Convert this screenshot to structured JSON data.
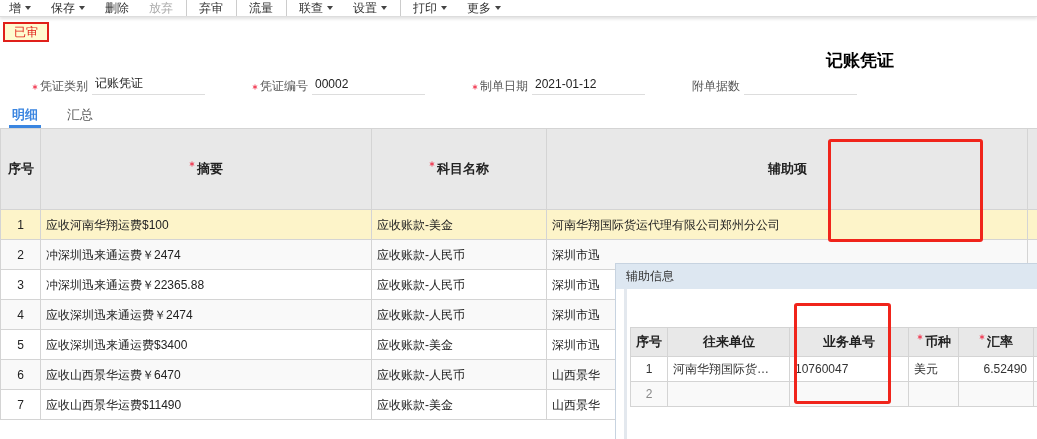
{
  "toolbar": [
    {
      "label": "增",
      "has_menu": true,
      "disabled": false,
      "separator_before": false
    },
    {
      "label": "保存",
      "has_menu": true,
      "disabled": false,
      "separator_before": false
    },
    {
      "label": "删除",
      "has_menu": false,
      "disabled": false,
      "separator_before": false
    },
    {
      "label": "放弃",
      "has_menu": false,
      "disabled": true,
      "separator_before": false
    },
    {
      "label": "弃审",
      "has_menu": false,
      "disabled": false,
      "separator_before": true
    },
    {
      "label": "流量",
      "has_menu": false,
      "disabled": false,
      "separator_before": true
    },
    {
      "label": "联查",
      "has_menu": true,
      "disabled": false,
      "separator_before": true
    },
    {
      "label": "设置",
      "has_menu": true,
      "disabled": false,
      "separator_before": false
    },
    {
      "label": "打印",
      "has_menu": true,
      "disabled": false,
      "separator_before": true
    },
    {
      "label": "更多",
      "has_menu": true,
      "disabled": false,
      "separator_before": false
    }
  ],
  "status_badge": "已审",
  "title": "记账凭证",
  "fields": [
    {
      "label": "凭证类别",
      "value": "记账凭证",
      "required": true
    },
    {
      "label": "凭证编号",
      "value": "00002",
      "required": true
    },
    {
      "label": "制单日期",
      "value": "2021-01-12",
      "required": true
    },
    {
      "label": "附单据数",
      "required": false
    }
  ],
  "tabs": [
    {
      "label": "明细",
      "selected": true
    },
    {
      "label": "汇总",
      "selected": false
    }
  ],
  "table": {
    "columns": [
      {
        "label": "序号",
        "required": false,
        "annotated": false
      },
      {
        "label": "摘要",
        "required": true,
        "annotated": false
      },
      {
        "label": "科目名称",
        "required": true,
        "annotated": false
      },
      {
        "label": "辅助项",
        "required": false,
        "annotated": true
      }
    ],
    "rows": [
      {
        "selected": true,
        "cells": [
          "1",
          "应收河南华翔运费$100",
          "应收账款-美金",
          "河南华翔国际货运代理有限公司郑州分公司"
        ]
      },
      {
        "selected": false,
        "cells": [
          "2",
          "冲深圳迅来通运费￥2474",
          "应收账款-人民币",
          "深圳市迅"
        ]
      },
      {
        "selected": false,
        "cells": [
          "3",
          "冲深圳迅来通运费￥22365.88",
          "应收账款-人民币",
          "深圳市迅"
        ]
      },
      {
        "selected": false,
        "cells": [
          "4",
          "应收深圳迅来通运费￥2474",
          "应收账款-人民币",
          "深圳市迅"
        ]
      },
      {
        "selected": false,
        "cells": [
          "5",
          "应收深圳迅来通运费$3400",
          "应收账款-美金",
          "深圳市迅"
        ]
      },
      {
        "selected": false,
        "cells": [
          "6",
          "应收山西景华运费￥6470",
          "应收账款-人民币",
          "山西景华"
        ]
      },
      {
        "selected": false,
        "cells": [
          "7",
          "应收山西景华运费$11490",
          "应收账款-美金",
          "山西景华"
        ]
      }
    ]
  },
  "aux_dialog": {
    "title": "辅助信息",
    "columns": [
      {
        "label": "序号",
        "required": false,
        "annotated": false
      },
      {
        "label": "往来单位",
        "required": false,
        "annotated": false
      },
      {
        "label": "业务单号",
        "required": false,
        "annotated": true
      },
      {
        "label": "币种",
        "required": true,
        "annotated": false
      },
      {
        "label": "汇率",
        "required": true,
        "annotated": false
      }
    ],
    "rows": [
      {
        "blank": false,
        "cells": [
          "1",
          "河南华翔国际货…",
          "10760047",
          "美元",
          "6.52490"
        ]
      },
      {
        "blank": true,
        "cells": [
          "2",
          "",
          "",
          "",
          ""
        ]
      }
    ]
  }
}
